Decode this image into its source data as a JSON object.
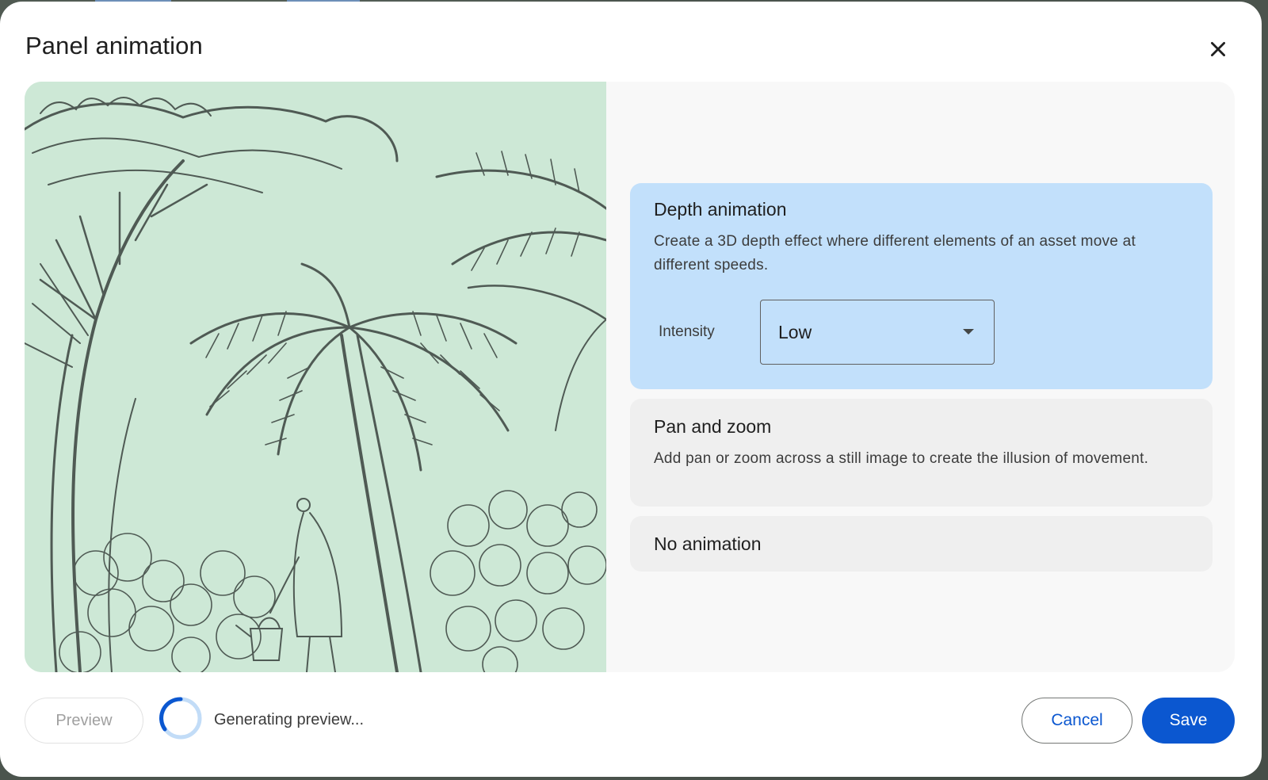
{
  "dialog": {
    "title": "Panel animation",
    "close_icon": "close-icon"
  },
  "preview_image": {
    "subject": "pencil-sketch-garden-illustration"
  },
  "options": [
    {
      "title": "Depth animation",
      "description": "Create a 3D depth effect where different elements of an asset move at different speeds.",
      "selected": true,
      "intensity_label": "Intensity",
      "intensity_value": "Low"
    },
    {
      "title": "Pan and zoom",
      "description": "Add pan or zoom across a still image to create the illusion of movement.",
      "selected": false
    },
    {
      "title": "No animation",
      "selected": false
    }
  ],
  "footer": {
    "preview_label": "Preview",
    "status": "Generating preview...",
    "cancel_label": "Cancel",
    "save_label": "Save"
  },
  "colors": {
    "accent": "#0b57d0",
    "selected_card": "#c2e0fb",
    "card": "#efefef",
    "image_tint": "#cfe9d8"
  },
  "icons": [
    "close-icon",
    "dropdown-arrow-icon",
    "loading-spinner-icon"
  ]
}
